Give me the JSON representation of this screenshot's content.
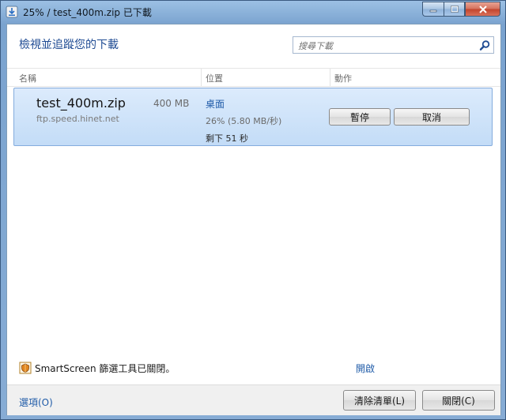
{
  "window": {
    "title": "25% / test_400m.zip 已下載",
    "controls": {
      "minimize": "–",
      "maximize": "□",
      "close": "x"
    }
  },
  "header": {
    "title": "檢視並追蹤您的下載",
    "search_placeholder": "搜尋下載"
  },
  "columns": {
    "name": "名稱",
    "location": "位置",
    "actions": "動作"
  },
  "download": {
    "file_name": "test_400m.zip",
    "size": "400 MB",
    "source": "ftp.speed.hinet.net",
    "location": "桌面",
    "progress": "26% (5.80 MB/秒)",
    "progress_percent": 26,
    "remaining": "剩下  51 秒",
    "pause_label": "暫停",
    "cancel_label": "取消"
  },
  "smartscreen": {
    "text": "SmartScreen 篩選工具已關閉。",
    "enable_link": "開啟"
  },
  "footer": {
    "options_link": "選項(O)",
    "clear_label": "清除清單(L)",
    "close_label": "關閉(C)"
  },
  "colors": {
    "accent": "#1f5ba8",
    "row_highlight": "#c3dcf7",
    "title_text": "#1f4b93"
  }
}
